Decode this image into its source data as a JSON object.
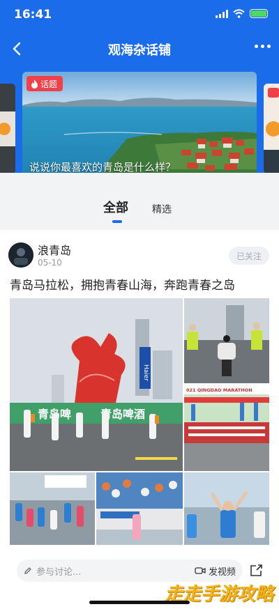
{
  "status_bar": {
    "time": "16:41"
  },
  "nav": {
    "title": "观海杂话铺"
  },
  "banner": {
    "tag": "话题",
    "caption": "说说你最喜欢的青岛是什么样？"
  },
  "tabs": [
    {
      "label": "全部"
    },
    {
      "label": "精选"
    }
  ],
  "post": {
    "user_name": "浪青岛",
    "date": "05-10",
    "follow_label": "已关注",
    "text": "青岛马拉松，拥抱青春山海，奔跑青春之岛"
  },
  "photos": {
    "main_banner_a": "青岛啤",
    "main_banner_b": "青岛啤酒",
    "main_flag": "Haier",
    "marathon_title": "021 QINGDAO MARATHON"
  },
  "comment": {
    "placeholder": "参与讨论...",
    "video_label": "发视频"
  },
  "watermark": "走走手游攻略",
  "icons": [
    "back-arrow",
    "more-dots",
    "fire",
    "edit-pencil",
    "video-camera",
    "share"
  ]
}
